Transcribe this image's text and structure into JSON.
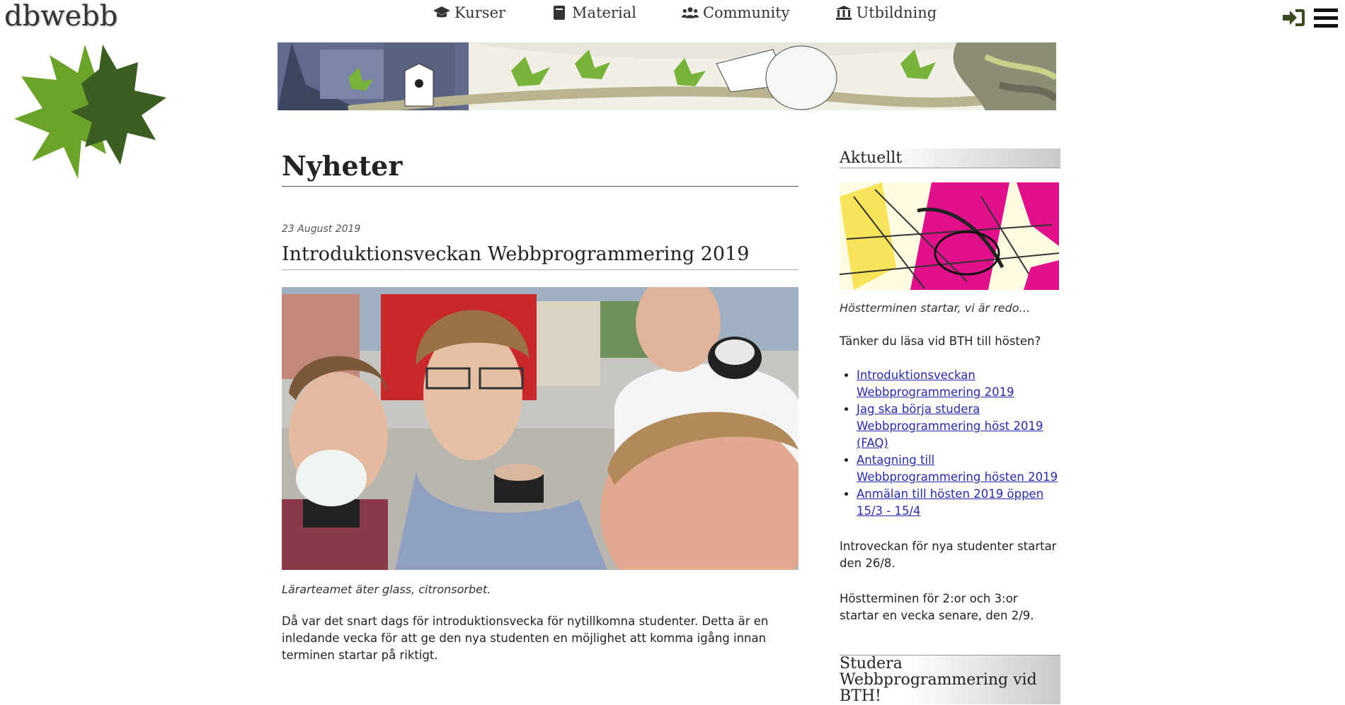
{
  "brand": {
    "logo_text": "dbwebb"
  },
  "nav": {
    "items": [
      {
        "label": "Kurser",
        "icon": "graduation-cap-icon"
      },
      {
        "label": "Material",
        "icon": "book-icon"
      },
      {
        "label": "Community",
        "icon": "users-icon"
      },
      {
        "label": "Utbildning",
        "icon": "institution-icon"
      }
    ],
    "login_icon": "sign-in-icon",
    "menu_icon": "hamburger-menu-icon"
  },
  "main": {
    "page_title": "Nyheter",
    "post": {
      "date": "23 August 2019",
      "title": "Introduktionsveckan Webbprogrammering 2019",
      "image_caption": "Lärarteamet äter glass, citronsorbet.",
      "body": "Då var det snart dags för introduktionsvecka för nytillkomna studenter. Detta är en inledande vecka för att ge den nya studenten en möjlighet att komma igång innan terminen startar på riktigt."
    }
  },
  "sidebar": {
    "heading": "Aktuellt",
    "image_caption": "Höstterminen startar, vi är redo…",
    "question": "Tänker du läsa vid BTH till hösten?",
    "links": [
      "Introduktionsveckan Webbprogrammering 2019",
      "Jag ska börja studera Webbprogrammering höst 2019 (FAQ)",
      "Antagning till Webbprogrammering hösten 2019",
      "Anmälan till hösten 2019 öppen 15/3 - 15/4"
    ],
    "intro_note": "Introveckan för nya studenter startar den 26/8.",
    "term_note": "Höstterminen för 2:or och 3:or startar en vecka senare, den 2/9.",
    "heading2": "Studera Webbprogrammering vid BTH!"
  },
  "colors": {
    "link": "#2a2aa6",
    "leaf_light": "#6aa22a",
    "leaf_dark": "#3c5e22",
    "icon_dark": "#3b4a1e"
  }
}
